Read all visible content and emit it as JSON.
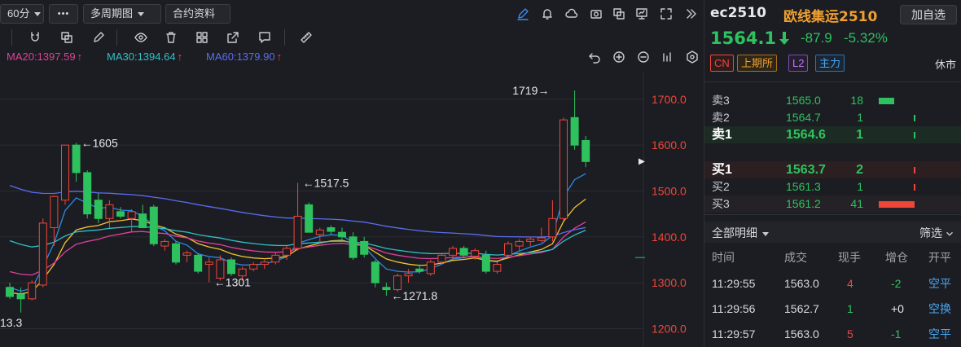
{
  "toolbar": {
    "period": "60分",
    "more_label": "•••",
    "multi_period": "多周期图",
    "contract_info": "合约资料"
  },
  "ma": {
    "ma20": "MA20:1397.59",
    "ma30": "MA30:1394.64",
    "ma60": "MA60:1379.90",
    "up_arrow": "↑",
    "colors": {
      "ma20": "#e0409a",
      "ma30": "#2fc0c8",
      "ma60": "#5b6cf0"
    }
  },
  "chart_data": {
    "type": "candlestick",
    "y_ticks": [
      "1700.0",
      "1600.0",
      "1500.0",
      "1400.0",
      "1300.0",
      "1200.0"
    ],
    "ylim": [
      1160,
      1760
    ],
    "annotations": [
      {
        "text": "1719→",
        "x_index": 49,
        "value": 1719,
        "side": "left"
      },
      {
        "text": "←1605",
        "x_index": 6,
        "value": 1605,
        "side": "right"
      },
      {
        "text": "←1517.5",
        "x_index": 26,
        "value": 1517.5,
        "side": "right"
      },
      {
        "text": "←1301",
        "x_index": 18,
        "value": 1301,
        "side": "right"
      },
      {
        "text": "←1271.8",
        "x_index": 34,
        "value": 1271.8,
        "side": "right"
      },
      {
        "text": "13.3",
        "x_index": 0,
        "value": 1213.3,
        "side": "cut"
      }
    ],
    "candles": [
      {
        "o": 1290,
        "h": 1300,
        "l": 1265,
        "c": 1270
      },
      {
        "o": 1275,
        "h": 1290,
        "l": 1235,
        "c": 1265
      },
      {
        "o": 1265,
        "h": 1305,
        "l": 1262,
        "c": 1300
      },
      {
        "o": 1295,
        "h": 1440,
        "l": 1290,
        "c": 1430
      },
      {
        "o": 1420,
        "h": 1490,
        "l": 1380,
        "c": 1488
      },
      {
        "o": 1480,
        "h": 1600,
        "l": 1470,
        "c": 1600
      },
      {
        "o": 1600,
        "h": 1605,
        "l": 1520,
        "c": 1540
      },
      {
        "o": 1540,
        "h": 1545,
        "l": 1440,
        "c": 1450
      },
      {
        "o": 1480,
        "h": 1495,
        "l": 1430,
        "c": 1440
      },
      {
        "o": 1440,
        "h": 1480,
        "l": 1420,
        "c": 1470
      },
      {
        "o": 1455,
        "h": 1465,
        "l": 1440,
        "c": 1445
      },
      {
        "o": 1440,
        "h": 1460,
        "l": 1410,
        "c": 1455
      },
      {
        "o": 1450,
        "h": 1470,
        "l": 1430,
        "c": 1420
      },
      {
        "o": 1465,
        "h": 1470,
        "l": 1380,
        "c": 1385
      },
      {
        "o": 1380,
        "h": 1395,
        "l": 1370,
        "c": 1390
      },
      {
        "o": 1385,
        "h": 1390,
        "l": 1340,
        "c": 1345
      },
      {
        "o": 1360,
        "h": 1370,
        "l": 1345,
        "c": 1365
      },
      {
        "o": 1360,
        "h": 1365,
        "l": 1320,
        "c": 1325
      },
      {
        "o": 1340,
        "h": 1355,
        "l": 1301,
        "c": 1345
      },
      {
        "o": 1310,
        "h": 1360,
        "l": 1305,
        "c": 1350
      },
      {
        "o": 1350,
        "h": 1355,
        "l": 1315,
        "c": 1320
      },
      {
        "o": 1315,
        "h": 1335,
        "l": 1305,
        "c": 1330
      },
      {
        "o": 1330,
        "h": 1345,
        "l": 1325,
        "c": 1340
      },
      {
        "o": 1340,
        "h": 1350,
        "l": 1330,
        "c": 1345
      },
      {
        "o": 1345,
        "h": 1365,
        "l": 1340,
        "c": 1360
      },
      {
        "o": 1360,
        "h": 1380,
        "l": 1350,
        "c": 1375
      },
      {
        "o": 1375,
        "h": 1517.5,
        "l": 1370,
        "c": 1445
      },
      {
        "o": 1470,
        "h": 1475,
        "l": 1410,
        "c": 1410
      },
      {
        "o": 1405,
        "h": 1420,
        "l": 1385,
        "c": 1415
      },
      {
        "o": 1420,
        "h": 1425,
        "l": 1405,
        "c": 1412
      },
      {
        "o": 1410,
        "h": 1420,
        "l": 1395,
        "c": 1400
      },
      {
        "o": 1400,
        "h": 1410,
        "l": 1350,
        "c": 1355
      },
      {
        "o": 1390,
        "h": 1400,
        "l": 1355,
        "c": 1362
      },
      {
        "o": 1345,
        "h": 1350,
        "l": 1290,
        "c": 1300
      },
      {
        "o": 1290,
        "h": 1300,
        "l": 1271.8,
        "c": 1285
      },
      {
        "o": 1285,
        "h": 1320,
        "l": 1280,
        "c": 1315
      },
      {
        "o": 1315,
        "h": 1330,
        "l": 1300,
        "c": 1320
      },
      {
        "o": 1330,
        "h": 1340,
        "l": 1320,
        "c": 1325
      },
      {
        "o": 1320,
        "h": 1350,
        "l": 1315,
        "c": 1345
      },
      {
        "o": 1345,
        "h": 1365,
        "l": 1340,
        "c": 1360
      },
      {
        "o": 1360,
        "h": 1380,
        "l": 1350,
        "c": 1375
      },
      {
        "o": 1375,
        "h": 1380,
        "l": 1355,
        "c": 1360
      },
      {
        "o": 1358,
        "h": 1375,
        "l": 1350,
        "c": 1370
      },
      {
        "o": 1360,
        "h": 1370,
        "l": 1320,
        "c": 1325
      },
      {
        "o": 1325,
        "h": 1345,
        "l": 1320,
        "c": 1340
      },
      {
        "o": 1360,
        "h": 1390,
        "l": 1355,
        "c": 1385
      },
      {
        "o": 1380,
        "h": 1395,
        "l": 1370,
        "c": 1390
      },
      {
        "o": 1390,
        "h": 1400,
        "l": 1380,
        "c": 1395
      },
      {
        "o": 1392,
        "h": 1420,
        "l": 1388,
        "c": 1398
      },
      {
        "o": 1400,
        "h": 1480,
        "l": 1390,
        "c": 1440
      },
      {
        "o": 1440,
        "h": 1660,
        "l": 1435,
        "c": 1655
      },
      {
        "o": 1660,
        "h": 1719,
        "l": 1590,
        "c": 1600
      },
      {
        "o": 1610,
        "h": 1620,
        "l": 1552,
        "c": 1564.1
      }
    ],
    "current_price": 1564.1
  },
  "quote": {
    "code": "ec2510",
    "name": "欧线集运2510",
    "add_fav": "加自选",
    "price": "1564.1",
    "change": "-87.9",
    "pct": "-5.32%",
    "tags": [
      "CN",
      "上期所",
      "L2",
      "主力"
    ],
    "status": "休市"
  },
  "orderbook": {
    "asks": [
      {
        "label": "卖3",
        "price": "1565.0",
        "qty": "18",
        "bar": 0.44
      },
      {
        "label": "卖2",
        "price": "1564.7",
        "qty": "1",
        "bar": 0.03
      },
      {
        "label": "卖1",
        "price": "1564.6",
        "qty": "1",
        "bar": 0.03
      }
    ],
    "bids": [
      {
        "label": "买1",
        "price": "1563.7",
        "qty": "2",
        "bar": 0.05
      },
      {
        "label": "买2",
        "price": "1561.3",
        "qty": "1",
        "bar": 0.03
      },
      {
        "label": "买3",
        "price": "1561.2",
        "qty": "41",
        "bar": 1.0
      }
    ]
  },
  "trades": {
    "section_title": "全部明细",
    "filter": "筛选",
    "headers": [
      "时间",
      "成交",
      "现手",
      "增仓",
      "开平"
    ],
    "rows": [
      {
        "time": "11:29:55",
        "price": "1563.0",
        "vol": "4",
        "oi": "-2",
        "type": "空平",
        "vol_color": "#f0463a",
        "oi_color": "#2ec25e"
      },
      {
        "time": "11:29:56",
        "price": "1562.7",
        "vol": "1",
        "oi": "+0",
        "type": "空换",
        "vol_color": "#2ec25e",
        "oi_color": "#e6e8ec"
      },
      {
        "time": "11:29:57",
        "price": "1563.0",
        "vol": "5",
        "oi": "-1",
        "type": "空平",
        "vol_color": "#f0463a",
        "oi_color": "#2ec25e"
      }
    ]
  }
}
